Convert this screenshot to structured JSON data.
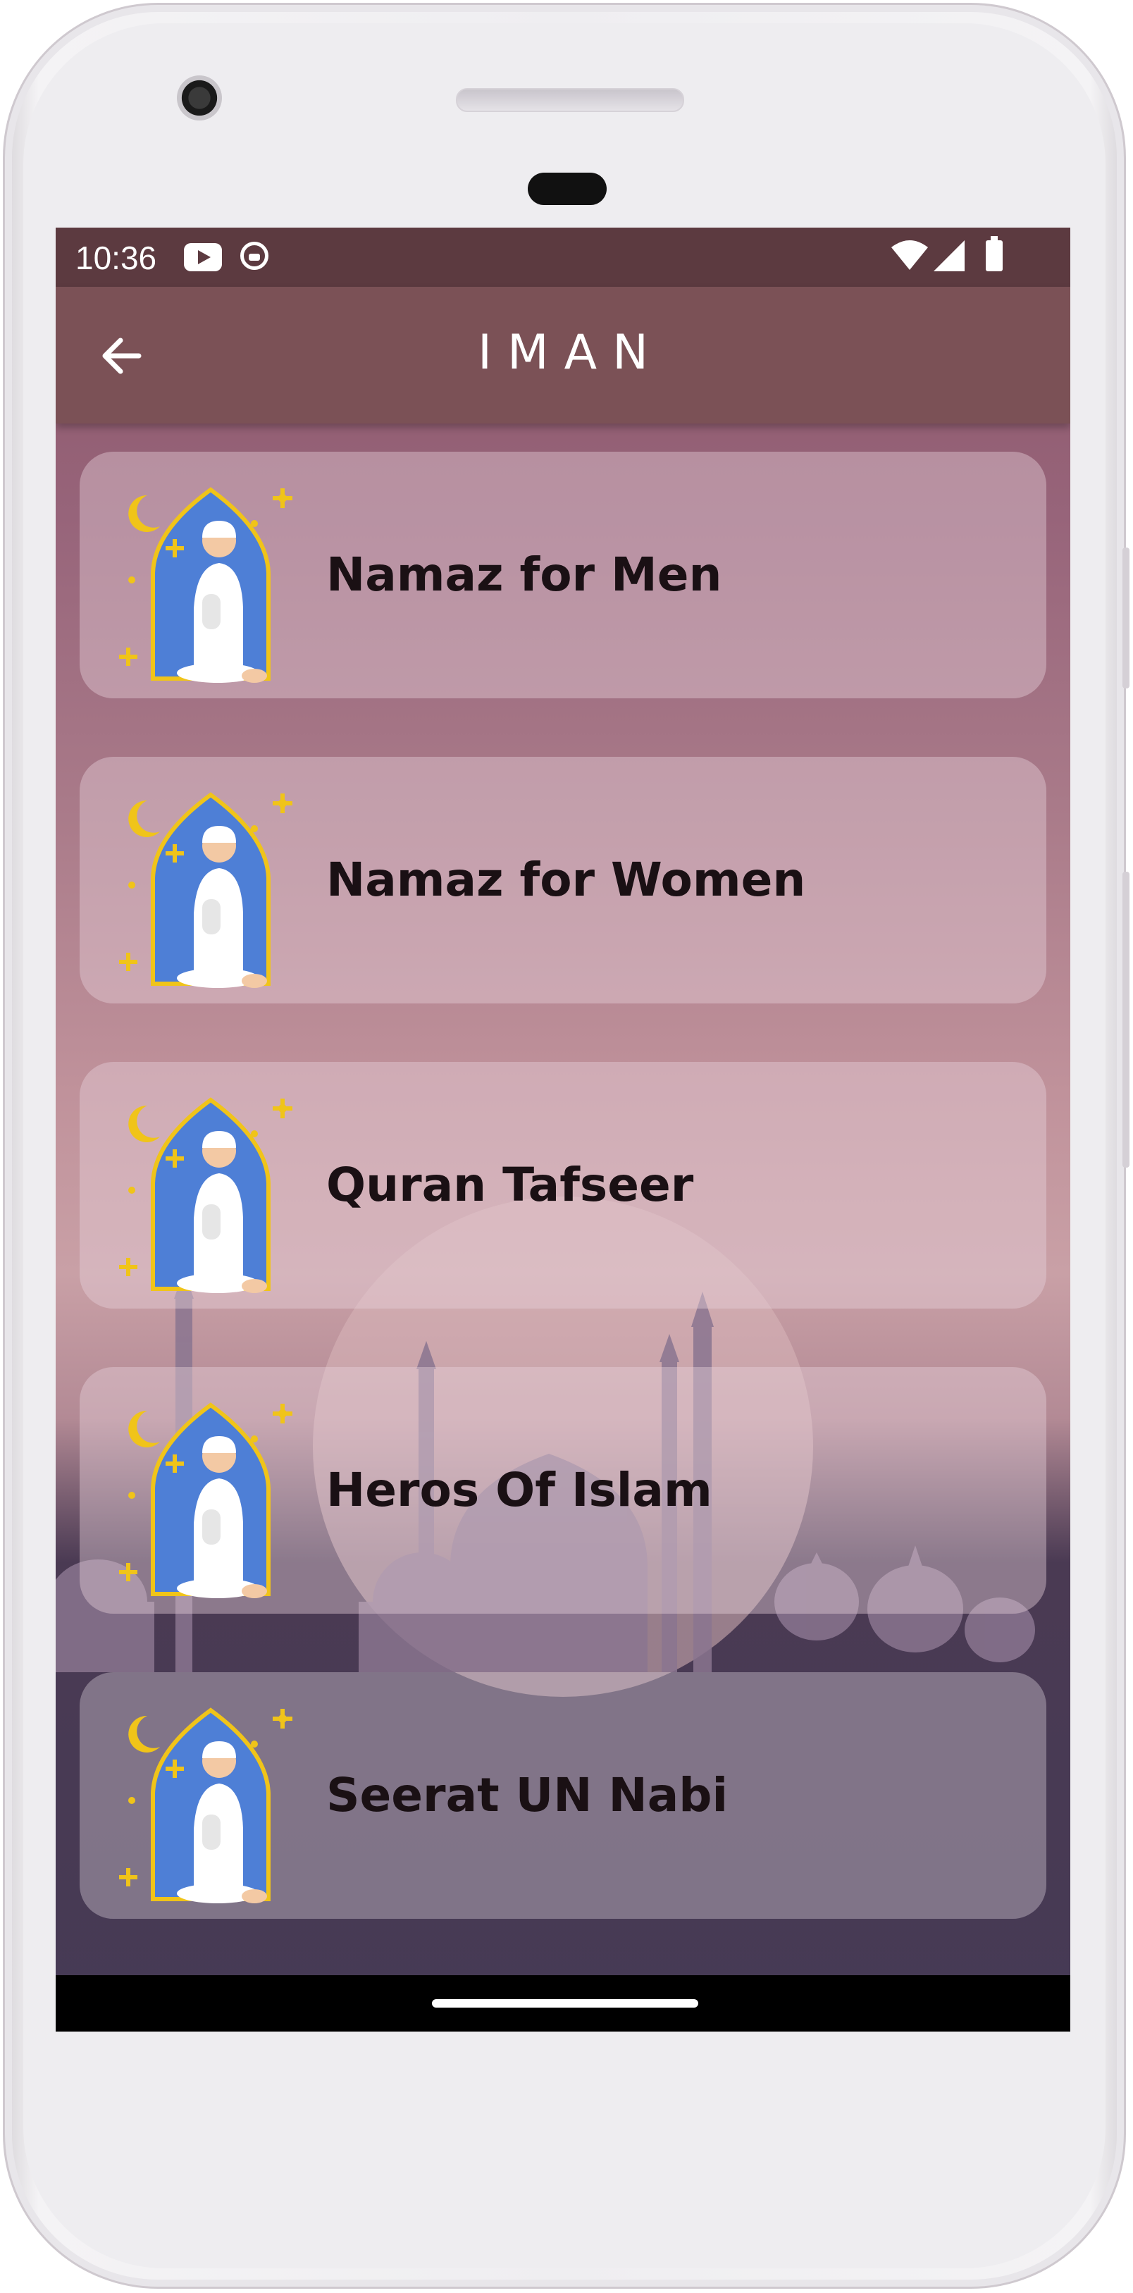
{
  "status_bar": {
    "time": "10:36",
    "icons": [
      "youtube-icon",
      "circle-app-icon",
      "wifi-icon",
      "signal-icon",
      "battery-icon"
    ]
  },
  "app_bar": {
    "title": "IMAN",
    "back_icon": "arrow-left-icon"
  },
  "menu": {
    "items": [
      {
        "label": "Namaz for Men",
        "icon": "praying-man-icon"
      },
      {
        "label": "Namaz for Women",
        "icon": "praying-man-icon"
      },
      {
        "label": "Quran Tafseer",
        "icon": "praying-man-icon"
      },
      {
        "label": "Heros Of Islam",
        "icon": "praying-man-icon"
      },
      {
        "label": "Seerat UN Nabi",
        "icon": "praying-man-icon"
      }
    ]
  },
  "colors": {
    "status_bar": "#5c3a40",
    "app_bar": "#7b5156",
    "icon_arch": "#4e7fd6",
    "icon_gold": "#f0c419",
    "text": "#1a1014"
  }
}
